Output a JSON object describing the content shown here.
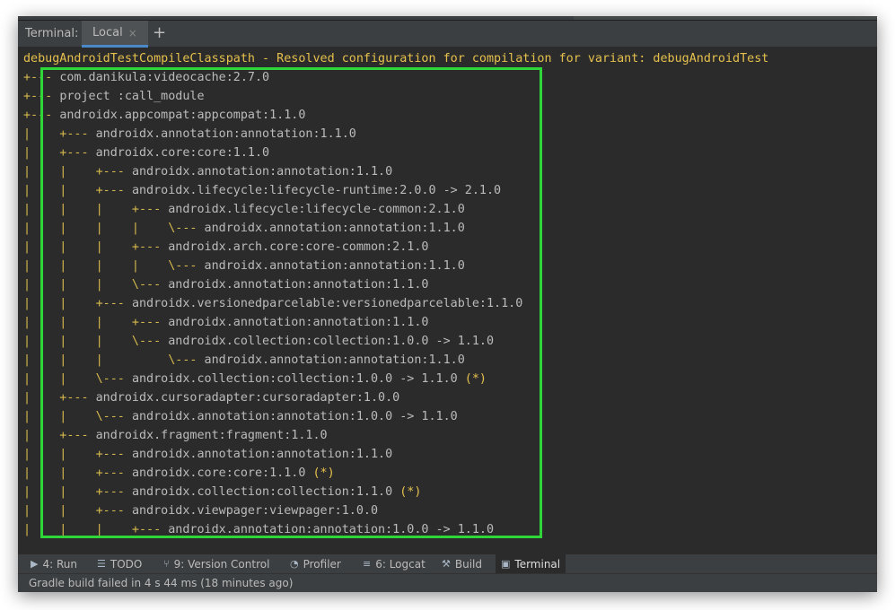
{
  "tabbar": {
    "caption": "Terminal:",
    "active_tab": "Local",
    "close_glyph": "×",
    "add_glyph": "+"
  },
  "terminal": {
    "header": "debugAndroidTestCompileClasspath - Resolved configuration for compilation for variant: debugAndroidTest",
    "lines": [
      {
        "tree": "+--- ",
        "dep": "com.danikula:videocache:2.7.0",
        "star": ""
      },
      {
        "tree": "+--- ",
        "dep": "project :call_module",
        "star": ""
      },
      {
        "tree": "+--- ",
        "dep": "androidx.appcompat:appcompat:1.1.0",
        "star": ""
      },
      {
        "tree": "|    +--- ",
        "dep": "androidx.annotation:annotation:1.1.0",
        "star": ""
      },
      {
        "tree": "|    +--- ",
        "dep": "androidx.core:core:1.1.0",
        "star": ""
      },
      {
        "tree": "|    |    +--- ",
        "dep": "androidx.annotation:annotation:1.1.0",
        "star": ""
      },
      {
        "tree": "|    |    +--- ",
        "dep": "androidx.lifecycle:lifecycle-runtime:2.0.0 -> 2.1.0",
        "star": ""
      },
      {
        "tree": "|    |    |    +--- ",
        "dep": "androidx.lifecycle:lifecycle-common:2.1.0",
        "star": ""
      },
      {
        "tree": "|    |    |    |    \\--- ",
        "dep": "androidx.annotation:annotation:1.1.0",
        "star": ""
      },
      {
        "tree": "|    |    |    +--- ",
        "dep": "androidx.arch.core:core-common:2.1.0",
        "star": ""
      },
      {
        "tree": "|    |    |    |    \\--- ",
        "dep": "androidx.annotation:annotation:1.1.0",
        "star": ""
      },
      {
        "tree": "|    |    |    \\--- ",
        "dep": "androidx.annotation:annotation:1.1.0",
        "star": ""
      },
      {
        "tree": "|    |    +--- ",
        "dep": "androidx.versionedparcelable:versionedparcelable:1.1.0",
        "star": ""
      },
      {
        "tree": "|    |    |    +--- ",
        "dep": "androidx.annotation:annotation:1.1.0",
        "star": ""
      },
      {
        "tree": "|    |    |    \\--- ",
        "dep": "androidx.collection:collection:1.0.0 -> 1.1.0",
        "star": ""
      },
      {
        "tree": "|    |    |         \\--- ",
        "dep": "androidx.annotation:annotation:1.1.0",
        "star": ""
      },
      {
        "tree": "|    |    \\--- ",
        "dep": "androidx.collection:collection:1.0.0 -> 1.1.0 ",
        "star": "(*)"
      },
      {
        "tree": "|    +--- ",
        "dep": "androidx.cursoradapter:cursoradapter:1.0.0",
        "star": ""
      },
      {
        "tree": "|    |    \\--- ",
        "dep": "androidx.annotation:annotation:1.0.0 -> 1.1.0",
        "star": ""
      },
      {
        "tree": "|    +--- ",
        "dep": "androidx.fragment:fragment:1.1.0",
        "star": ""
      },
      {
        "tree": "|    |    +--- ",
        "dep": "androidx.annotation:annotation:1.1.0",
        "star": ""
      },
      {
        "tree": "|    |    +--- ",
        "dep": "androidx.core:core:1.1.0 ",
        "star": "(*)"
      },
      {
        "tree": "|    |    +--- ",
        "dep": "androidx.collection:collection:1.1.0 ",
        "star": "(*)"
      },
      {
        "tree": "|    |    +--- ",
        "dep": "androidx.viewpager:viewpager:1.0.0",
        "star": ""
      },
      {
        "tree": "|    |    |    +--- ",
        "dep": "androidx.annotation:annotation:1.0.0 -> 1.1.0",
        "star": ""
      }
    ]
  },
  "toolwindows": [
    {
      "name": "run",
      "icon": "▶",
      "label": "4: Run",
      "active": false
    },
    {
      "name": "todo",
      "icon": "☰",
      "label": "TODO",
      "active": false
    },
    {
      "name": "version-control",
      "icon": "⑂",
      "label": "9: Version Control",
      "active": false
    },
    {
      "name": "profiler",
      "icon": "◔",
      "label": "Profiler",
      "active": false
    },
    {
      "name": "logcat",
      "icon": "≡",
      "label": "6: Logcat",
      "active": false
    },
    {
      "name": "build",
      "icon": "⚒",
      "label": "Build",
      "active": false
    },
    {
      "name": "terminal",
      "icon": "▣",
      "label": "Terminal",
      "active": true
    }
  ],
  "status": {
    "message": "Gradle build failed in 4 s 44 ms (18 minutes ago)"
  },
  "colors": {
    "background": "#2b2b2b",
    "tree_yellow": "#d6b94c",
    "highlight_green": "#2ed63a",
    "text": "#bbbbbb"
  }
}
